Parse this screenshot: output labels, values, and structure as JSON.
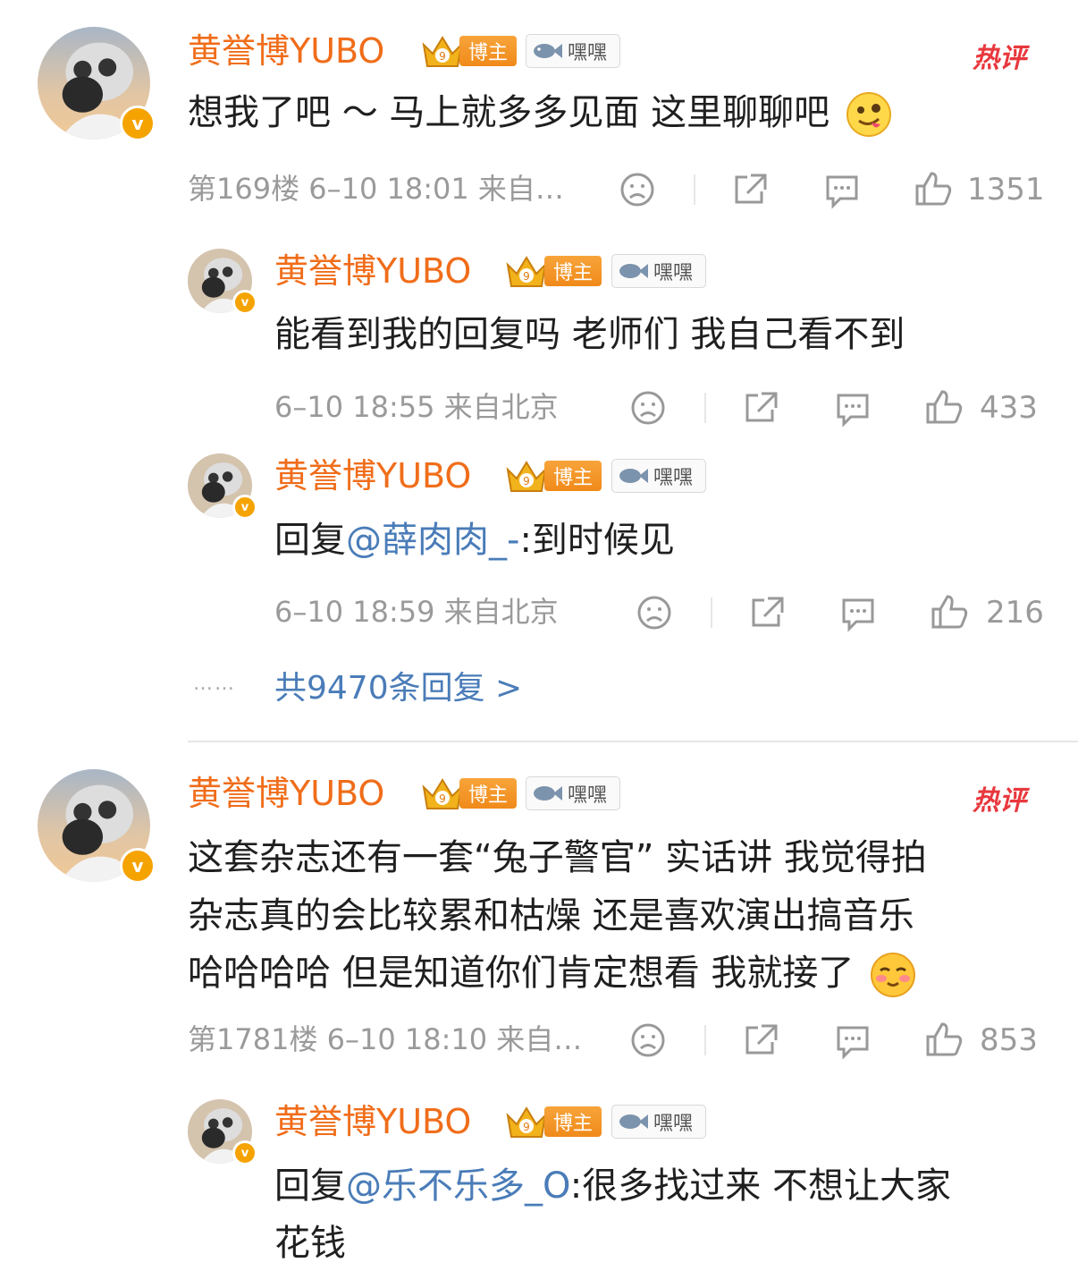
{
  "comments": [
    {
      "username": "黄誉博YUBO",
      "badge_label": "博主",
      "fan_label": "嘿嘿",
      "hot_label": "热评",
      "verified": "v",
      "text_lines": [
        "想我了吧 ～ 马上就多多见面 这里聊聊吧"
      ],
      "emoji": "tongue-emoji",
      "meta": "第169楼 6–10 18:01 来自…",
      "likes": "1351"
    },
    {
      "username": "黄誉博YUBO",
      "badge_label": "博主",
      "fan_label": "嘿嘿",
      "hot_label": "热评",
      "verified": "v",
      "text_lines": [
        "这套杂志还有一套“兔子警官” 实话讲 我觉得拍",
        "杂志真的会比较累和枯燥 还是喜欢演出搞音乐",
        "哈哈哈哈 但是知道你们肯定想看 我就接了"
      ],
      "emoji": "shy-emoji",
      "meta": "第1781楼 6–10 18:10 来自…",
      "likes": "853"
    }
  ],
  "replies": [
    {
      "username": "黄誉博YUBO",
      "badge_label": "博主",
      "fan_label": "嘿嘿",
      "text": "能看到我的回复吗 老师们 我自己看不到",
      "meta": "6–10 18:55 来自北京",
      "likes": "433"
    },
    {
      "username": "黄誉博YUBO",
      "badge_label": "博主",
      "fan_label": "嘿嘿",
      "prefix": "回复",
      "mention": "@薛肉肉_-",
      "text": ":到时候见",
      "meta": "6–10 18:59 来自北京",
      "likes": "216"
    },
    {
      "username": "黄誉博YUBO",
      "badge_label": "博主",
      "fan_label": "嘿嘿",
      "prefix": "回复",
      "mention": "@乐不乐多_O",
      "text": ":很多找过来 不想让大家",
      "text2": "花钱"
    }
  ],
  "more_replies": {
    "dots": "……",
    "label": "共9470条回复 >"
  },
  "colors": {
    "username": "#f06d1a",
    "link": "#4a7cb8",
    "meta": "#9a9a9a",
    "hot": "#e8383d",
    "badge": "#f08a1a"
  }
}
